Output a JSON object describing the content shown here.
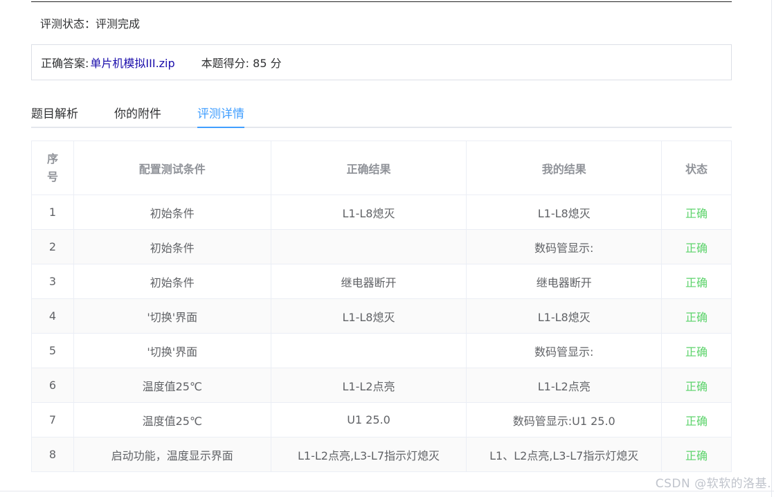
{
  "status": {
    "text": "评测状态：评测完成"
  },
  "answer": {
    "label": "正确答案:",
    "file_link": "单片机模拟III.zip",
    "score_text": "本题得分: 85 分"
  },
  "tabs": [
    {
      "label": "题目解析",
      "active": false
    },
    {
      "label": "你的附件",
      "active": false
    },
    {
      "label": "评测详情",
      "active": true
    }
  ],
  "table": {
    "headers": {
      "index": "序号",
      "index_line1": "序",
      "index_line2": "号",
      "condition": "配置测试条件",
      "expected": "正确结果",
      "mine": "我的结果",
      "state": "状态"
    },
    "rows": [
      {
        "index": "1",
        "condition": "初始条件",
        "expected": "L1-L8熄灭",
        "mine": "L1-L8熄灭",
        "state": "正确"
      },
      {
        "index": "2",
        "condition": "初始条件",
        "expected": "",
        "mine": "数码管显示:",
        "state": "正确"
      },
      {
        "index": "3",
        "condition": "初始条件",
        "expected": "继电器断开",
        "mine": "继电器断开",
        "state": "正确"
      },
      {
        "index": "4",
        "condition": "'切换'界面",
        "expected": "L1-L8熄灭",
        "mine": "L1-L8熄灭",
        "state": "正确"
      },
      {
        "index": "5",
        "condition": "'切换'界面",
        "expected": "",
        "mine": "数码管显示:",
        "state": "正确"
      },
      {
        "index": "6",
        "condition": "温度值25℃",
        "expected": "L1-L2点亮",
        "mine": "L1-L2点亮",
        "state": "正确"
      },
      {
        "index": "7",
        "condition": "温度值25℃",
        "expected": "U1 25.0",
        "mine": "数码管显示:U1 25.0",
        "state": "正确"
      },
      {
        "index": "8",
        "condition": "启动功能，温度显示界面",
        "expected": "L1-L2点亮,L3-L7指示灯熄灭",
        "mine": "L1、L2点亮,L3-L7指示灯熄灭",
        "state": "正确"
      }
    ]
  },
  "watermark": "CSDN @软软的洛基.",
  "colors": {
    "accent": "#409eff",
    "success": "#5cd36b",
    "link": "#1a0dab"
  }
}
